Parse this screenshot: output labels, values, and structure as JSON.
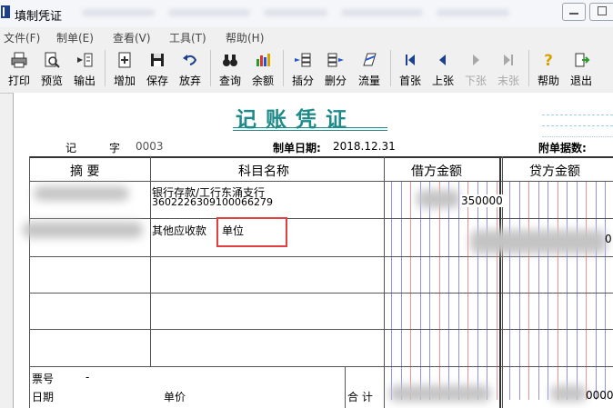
{
  "window": {
    "title": "填制凭证"
  },
  "menu": [
    {
      "label": "文件(F)"
    },
    {
      "label": "制单(E)"
    },
    {
      "label": "查看(V)"
    },
    {
      "label": "工具(T)"
    },
    {
      "label": "帮助(H)"
    }
  ],
  "toolbar": {
    "print": "打印",
    "preview": "预览",
    "export": "输出",
    "add": "增加",
    "save": "保存",
    "discard": "放弃",
    "query": "查询",
    "balance": "余额",
    "insert_entry": "插分",
    "delete_entry": "删分",
    "cash_flow": "流量",
    "first": "首张",
    "prev": "上张",
    "next": "下张",
    "last": "末张",
    "help": "帮助",
    "exit": "退出"
  },
  "voucher": {
    "title": "记账凭证",
    "type_label": "记",
    "number_label": "字",
    "number": "0003",
    "date_label": "制单日期:",
    "date": "2018.12.31",
    "attach_label": "附单据数:",
    "headers": {
      "summary": "摘 要",
      "account": "科目名称",
      "debit": "借方金额",
      "credit": "贷方金额"
    },
    "rows": [
      {
        "account_line1": "银行存款/工行东涌支行",
        "account_line2": "3602226309100066279",
        "debit_visible": "350000"
      },
      {
        "account_line1": "其他应收款",
        "account_input": "单位",
        "credit_visible": "0"
      }
    ],
    "footer": {
      "ticket_no_label": "票号",
      "ticket_no_value": "-",
      "date_label": "日期",
      "unit_price_label": "单价",
      "total_label": "合 计",
      "total_credit_visible": "0000"
    }
  },
  "colors": {
    "accent": "#1f8a8a",
    "highlight_box": "#e04040",
    "amount_line_blue": "#3a3ae0",
    "amount_line_red": "#e03a3a"
  },
  "icons": {
    "print": "printer-icon",
    "preview": "magnifier-icon",
    "export": "export-icon",
    "add": "add-doc-icon",
    "save": "floppy-icon",
    "discard": "undo-icon",
    "query": "binoculars-icon",
    "balance": "bar-chart-icon",
    "insert_entry": "insert-row-icon",
    "delete_entry": "delete-row-icon",
    "cash_flow": "cash-flow-icon",
    "first": "first-icon",
    "prev": "prev-icon",
    "next": "next-icon",
    "last": "last-icon",
    "help": "question-icon",
    "exit": "exit-door-icon"
  }
}
